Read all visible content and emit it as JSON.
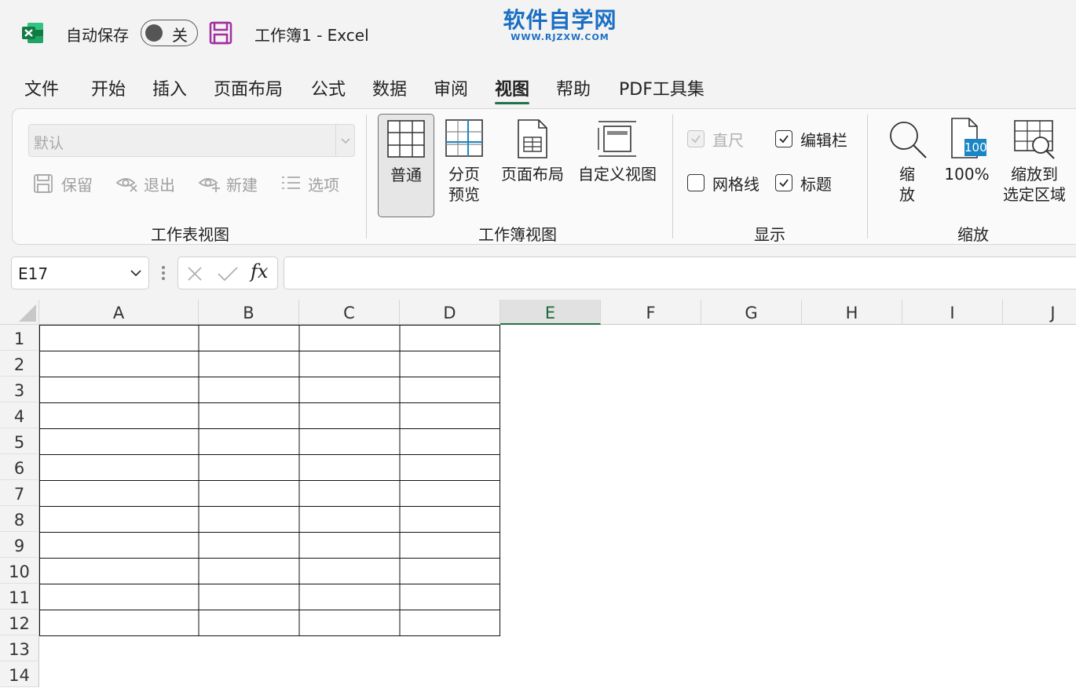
{
  "titlebar": {
    "autosave_label": "自动保存",
    "autosave_state": "关",
    "doc_title": "工作簿1  -  Excel",
    "watermark_main": "软件自学网",
    "watermark_sub": "WWW.RJZXW.COM"
  },
  "tabs": [
    {
      "label": "文件",
      "active": false
    },
    {
      "label": "开始",
      "active": false
    },
    {
      "label": "插入",
      "active": false
    },
    {
      "label": "页面布局",
      "active": false
    },
    {
      "label": "公式",
      "active": false
    },
    {
      "label": "数据",
      "active": false
    },
    {
      "label": "审阅",
      "active": false
    },
    {
      "label": "视图",
      "active": true
    },
    {
      "label": "帮助",
      "active": false
    },
    {
      "label": "PDF工具集",
      "active": false
    }
  ],
  "ribbon": {
    "sheet_view": {
      "label": "工作表视图",
      "select_value": "默认",
      "buttons": [
        "保留",
        "退出",
        "新建",
        "选项"
      ]
    },
    "workbook_view": {
      "label": "工作簿视图",
      "normal": "普通",
      "page_break_line1": "分页",
      "page_break_line2": "预览",
      "page_layout": "页面布局",
      "custom_views": "自定义视图"
    },
    "show": {
      "label": "显示",
      "ruler": "直尺",
      "formula_bar": "编辑栏",
      "gridlines": "网格线",
      "headings": "标题"
    },
    "zoom": {
      "label": "缩放",
      "zoom_line1": "缩",
      "zoom_line2": "放",
      "zoom_100": "100%",
      "zoom_100_badge": "100",
      "zoom_sel_line1": "缩放到",
      "zoom_sel_line2": "选定区域"
    }
  },
  "formula_bar": {
    "name_box": "E17",
    "fx": "fx"
  },
  "sheet": {
    "columns": [
      "A",
      "B",
      "C",
      "D",
      "E",
      "F",
      "G",
      "H",
      "I",
      "J"
    ],
    "selected_column": "E",
    "rows": [
      "1",
      "2",
      "3",
      "4",
      "5",
      "6",
      "7",
      "8",
      "9",
      "10",
      "11",
      "12",
      "13",
      "14"
    ]
  },
  "colors": {
    "accent": "#217346",
    "watermark": "#1a6fc4",
    "excel_icon": "#107c41",
    "save_icon": "#a02f9e"
  }
}
